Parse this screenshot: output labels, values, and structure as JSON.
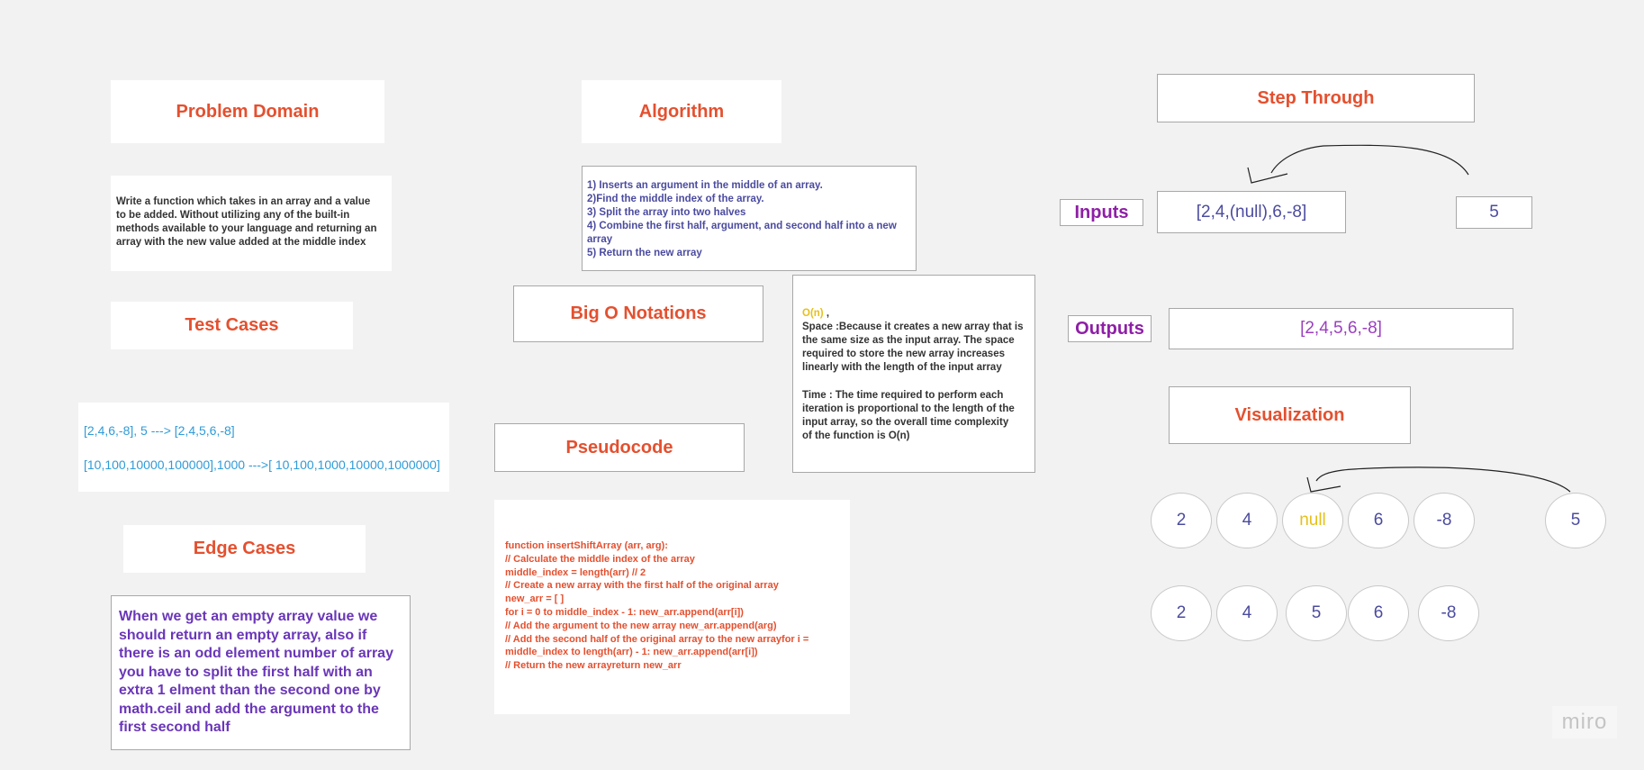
{
  "problem_domain": {
    "title": "Problem Domain",
    "text": "Write a function  which takes in an array and a value\nto be added. Without utilizing any of the built-in\nmethods available to your language and returning an\narray with the new value added at the middle index"
  },
  "test_cases": {
    "title": "Test Cases",
    "line1": "[2,4,6,-8], 5  --->    [2,4,5,6,-8]",
    "line2": "[10,100,10000,100000],1000 --->[ 10,100,1000,10000,1000000]"
  },
  "edge_cases": {
    "title": "Edge Cases",
    "text": "When we get an empty array value we\nshould return an empty array, also if\nthere is an odd element number of array\nyou have to split the first half with an\nextra 1 elment than the second one by\nmath.ceil and add the argument to the\nfirst second half"
  },
  "algorithm": {
    "title": "Algorithm",
    "steps": "1) Inserts an argument in the middle of an array.\n2)Find the middle index of the array.\n3) Split the array into two halves\n4) Combine the first half, argument, and second half into a new\narray\n5) Return the new array"
  },
  "big_o": {
    "title": "Big O Notations",
    "notation": "O(n)",
    "notation_suffix": " ,",
    "space": "Space :Because it creates a new array that is\nthe same size as the input array. The space\nrequired to store the new array increases\nlinearly with the length of the input array",
    "time": "Time : The time required to perform each\niteration is proportional to the length of the\ninput array, so the overall time complexity\nof the function is O(n)"
  },
  "pseudocode": {
    "title": "Pseudocode",
    "code": "function insertShiftArray (arr, arg):\n // Calculate the middle index of the array\n   middle_index = length(arr) // 2\n// Create a new array with the first half of the original array\nnew_arr = [ ]\n     for i = 0 to middle_index - 1:        new_arr.append(arr[i])\n // Add the argument to the new array     new_arr.append(arg)\n // Add the second half of the original array to the new arrayfor i =\nmiddle_index to length(arr) - 1:        new_arr.append(arr[i])\n // Return the new arrayreturn new_arr"
  },
  "step_through": {
    "title": "Step Through",
    "inputs_label": "Inputs",
    "input_array": "[2,4,(null),6,-8]",
    "input_value": "5",
    "outputs_label": "Outputs",
    "output_array": "[2,4,5,6,-8]"
  },
  "visualization": {
    "title": "Visualization",
    "row1": [
      "2",
      "4",
      "null",
      "6",
      "-8"
    ],
    "row1_insert": "5",
    "row2": [
      "2",
      "4",
      "5",
      "6",
      "-8"
    ],
    "null_color": "#e6c01a"
  },
  "brand": {
    "logo": "miro"
  }
}
